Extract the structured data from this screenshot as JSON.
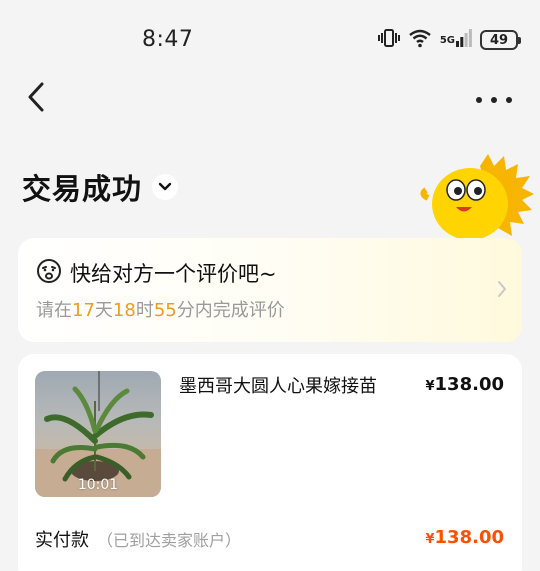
{
  "status_bar": {
    "time": "8:47",
    "network": "5G",
    "battery": "49"
  },
  "order": {
    "status": "交易成功"
  },
  "review": {
    "title": "快给对方一个评价吧~",
    "prefix": "请在",
    "days": "17",
    "days_unit": "天",
    "hours": "18",
    "hours_unit": "时",
    "minutes": "55",
    "minutes_unit": "分",
    "suffix": "内完成评价"
  },
  "product": {
    "title": "墨西哥大圆人心果嫁接苗",
    "price_symbol": "¥",
    "price": "138.00",
    "video_duration": "10:01"
  },
  "payment": {
    "label": "实付款",
    "note": "（已到达卖家账户）",
    "amount_symbol": "¥",
    "amount": "138.00"
  },
  "colors": {
    "accent_orange": "#f19b1b",
    "price_red": "#ff4f00",
    "mascot_yellow": "#ffd400"
  }
}
